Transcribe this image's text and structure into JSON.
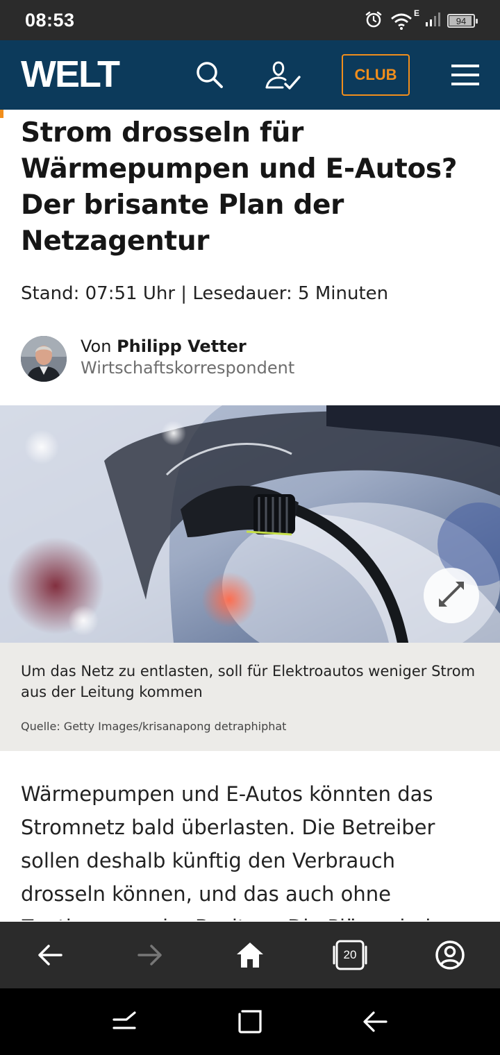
{
  "status_bar": {
    "time": "08:53",
    "network_label": "E",
    "battery": "94",
    "battery_level": 0.94,
    "icons": [
      "alarm-icon",
      "wifi-icon",
      "signal-icon",
      "battery-icon"
    ]
  },
  "header": {
    "logo": "WELT",
    "club_label": "CLUB",
    "icons": [
      "search-icon",
      "account-icon",
      "menu-icon"
    ],
    "colors": {
      "background": "#0c3a5b",
      "accent": "#f18e1c"
    }
  },
  "article": {
    "headline": "Strom drosseln für Wärmepumpen und E-Autos? Der brisante Plan der Netzagentur",
    "meta": "Stand: 07:51 Uhr | Lesedauer: 5 Minuten",
    "author_prefix": "Von",
    "author_name": "Philipp Vetter",
    "author_role": "Wirtschaftskorrespondent",
    "caption": "Um das Netz zu entlasten, soll für Elektroautos weniger Strom aus der Leitung kommen",
    "source": "Quelle: Getty Images/krisanapong detraphiphat",
    "body": "Wärmepumpen und E-Autos könnten das Stromnetz bald überlasten. Die Betreiber sollen deshalb künftig den Verbrauch drosseln können, und das auch ohne Zustimmung der Besitzer. Die Pläne sind"
  },
  "browser_toolbar": {
    "tab_count": "20",
    "icons": [
      "back-arrow-icon",
      "forward-arrow-icon",
      "home-icon",
      "tabs-icon",
      "profile-icon"
    ]
  },
  "system_nav": {
    "icons": [
      "recent-apps-icon",
      "home-square-icon",
      "back-icon"
    ]
  }
}
